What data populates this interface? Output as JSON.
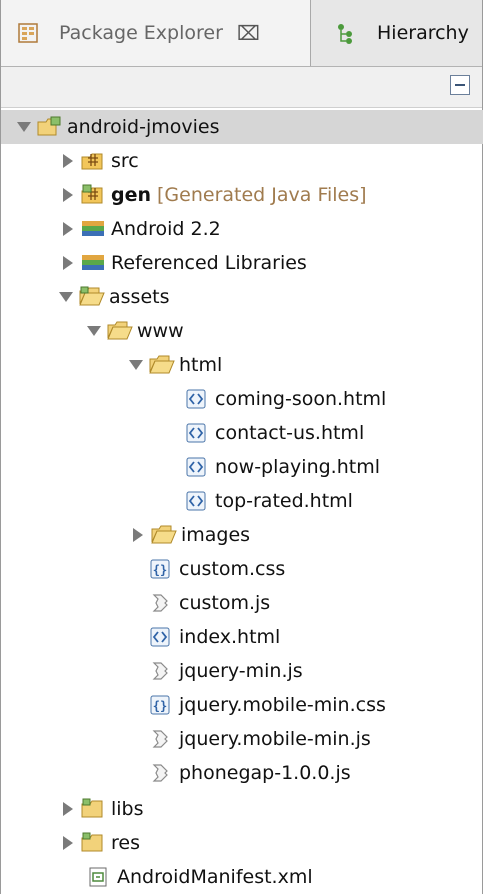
{
  "tabs": {
    "active_label": "Package Explorer",
    "active_close": "⌧",
    "other_label": "Hierarchy"
  },
  "tree": {
    "project": "android-jmovies",
    "src": "src",
    "gen": "gen",
    "gen_suffix": "[Generated Java Files]",
    "android": "Android 2.2",
    "reflibs": "Referenced Libraries",
    "assets": "assets",
    "www": "www",
    "html": "html",
    "html_files": [
      "coming-soon.html",
      "contact-us.html",
      "now-playing.html",
      "top-rated.html"
    ],
    "images": "images",
    "custom_css": "custom.css",
    "custom_js": "custom.js",
    "index_html": "index.html",
    "jquery_min": "jquery-min.js",
    "jqm_css": "jquery.mobile-min.css",
    "jqm_js": "jquery.mobile-min.js",
    "phonegap": "phonegap-1.0.0.js",
    "libs": "libs",
    "res": "res",
    "manifest": "AndroidManifest.xml"
  }
}
